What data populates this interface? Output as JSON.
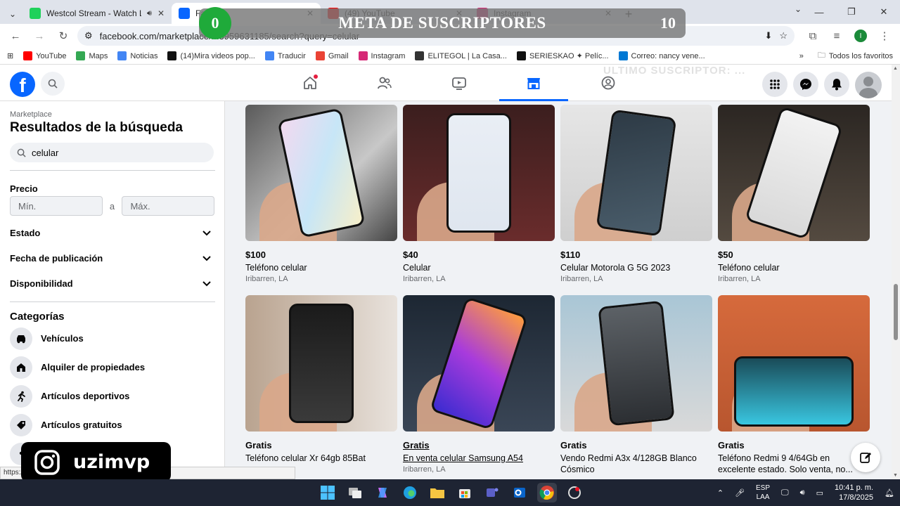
{
  "browser": {
    "tabs": [
      {
        "title": "Westcol Stream - Watch Li...",
        "color": "#1fd15a",
        "active": false,
        "audio": true
      },
      {
        "title": "Fa...",
        "color": "#0866ff",
        "active": true,
        "audio": false
      },
      {
        "title": "(49) YouTube",
        "color": "#ff0000",
        "active": false,
        "audio": false
      },
      {
        "title": "Instagram",
        "color": "#d62976",
        "active": false,
        "audio": false
      }
    ],
    "url": "facebook.com/marketplace/...3959631185/search?query=celular",
    "bookmarks": [
      {
        "label": "YouTube",
        "color": "#ff0000"
      },
      {
        "label": "Maps",
        "color": "#34a853"
      },
      {
        "label": "Noticias",
        "color": "#4285f4"
      },
      {
        "label": "(14)Mira videos pop...",
        "color": "#111111"
      },
      {
        "label": "Traducir",
        "color": "#4285f4"
      },
      {
        "label": "Gmail",
        "color": "#ea4335"
      },
      {
        "label": "Instagram",
        "color": "#d62976"
      },
      {
        "label": "ELITEGOL | La Casa...",
        "color": "#333333"
      },
      {
        "label": "SERIESKAO ✦ Pelíc...",
        "color": "#111111"
      },
      {
        "label": "Correo: nancy vene...",
        "color": "#0078d4"
      }
    ],
    "bookmarks_all": "Todos los favoritos",
    "profile_initial": "I"
  },
  "overlay": {
    "sub_count": "0",
    "title": "META DE SUSCRIPTORES",
    "goal": "10",
    "instagram_handle": "uzimvp",
    "watermark": "ULTIMO SUSCRIPTOR: ..."
  },
  "sidebar": {
    "section": "Marketplace",
    "title": "Resultados de la búsqueda",
    "search_value": "celular",
    "price_label": "Precio",
    "min_placeholder": "Mín.",
    "separator": "a",
    "max_placeholder": "Máx.",
    "filters": [
      "Estado",
      "Fecha de publicación",
      "Disponibilidad"
    ],
    "categories_title": "Categorías",
    "categories": [
      {
        "label": "Vehículos",
        "icon": "car-icon"
      },
      {
        "label": "Alquiler de propiedades",
        "icon": "house-icon"
      },
      {
        "label": "Artículos deportivos",
        "icon": "runner-icon"
      },
      {
        "label": "Artículos gratuitos",
        "icon": "tag-icon"
      }
    ]
  },
  "listings": [
    {
      "price": "$100",
      "title": "Teléfono celular",
      "location": "Iribarren, LA"
    },
    {
      "price": "$40",
      "title": "Celular",
      "location": "Iribarren, LA"
    },
    {
      "price": "$110",
      "title": "Celular Motorola G 5G 2023",
      "location": "Iribarren, LA"
    },
    {
      "price": "$50",
      "title": "Teléfono celular",
      "location": "Iribarren, LA"
    },
    {
      "price": "Gratis",
      "title": "Teléfono celular Xr 64gb 85Bat",
      "location": ""
    },
    {
      "price": "Gratis",
      "title": "En venta celular Samsung A54",
      "location": "Iribarren, LA",
      "hover": true
    },
    {
      "price": "Gratis",
      "title": "Vendo Redmi A3x 4/128GB Blanco Cósmico",
      "location": ""
    },
    {
      "price": "Gratis",
      "title": "Teléfono Redmi 9 4/64Gb en excelente estado. Solo venta, no...",
      "location": ""
    }
  ],
  "status_url": "https://.../419371705829/?ref=search&referral...",
  "taskbar": {
    "lang_top": "ESP",
    "lang_bottom": "LAA",
    "time": "10:41 p. m.",
    "date": "17/8/2025"
  },
  "colors": {
    "fb_blue": "#0866ff",
    "accent_green": "#1faa3a"
  }
}
